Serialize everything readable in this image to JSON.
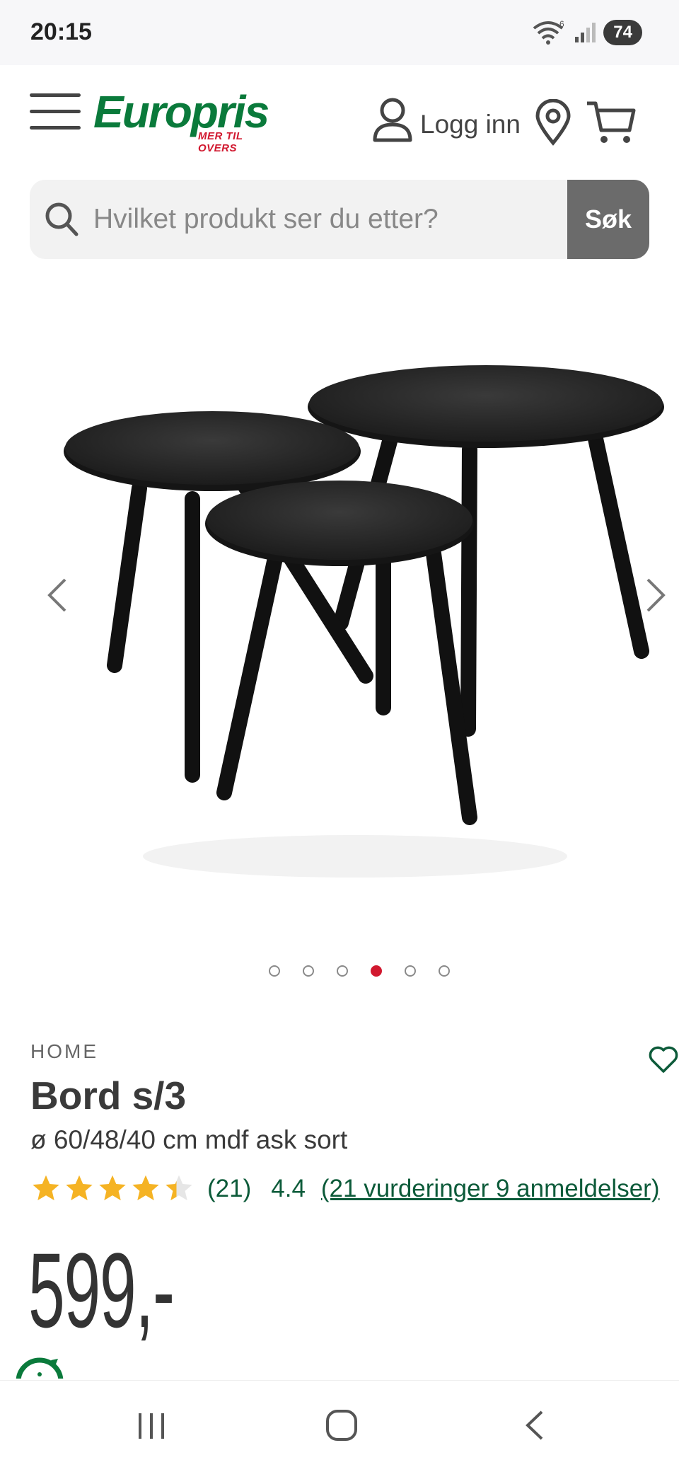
{
  "status_bar": {
    "time": "20:15",
    "wifi_sub": "6",
    "battery": "74"
  },
  "header": {
    "logo_text": "Europris",
    "logo_tagline": "MER TIL OVERS",
    "login_label": "Logg inn"
  },
  "search": {
    "placeholder": "Hvilket produkt ser du etter?",
    "button_label": "Søk"
  },
  "gallery": {
    "image_count": 6,
    "active_index": 3
  },
  "product": {
    "brand": "HOME",
    "title": "Bord s/3",
    "subtitle": "ø 60/48/40 cm mdf ask sort",
    "rating_count": "(21)",
    "rating_value": "4.4",
    "rating_stars": 4.4,
    "reviews_link": "(21 vurderinger 9 anmeldelser)",
    "price": "599,-"
  },
  "colors": {
    "brand_green": "#0a7a3b",
    "brand_red": "#d1182f",
    "link_green": "#0d5b3a",
    "star_yellow": "#f5b324"
  },
  "icons": [
    "menu-icon",
    "user-icon",
    "location-icon",
    "cart-icon",
    "search-icon",
    "chevron-left-icon",
    "chevron-right-icon",
    "heart-icon",
    "star-icon",
    "recents-icon",
    "home-icon",
    "back-icon"
  ]
}
